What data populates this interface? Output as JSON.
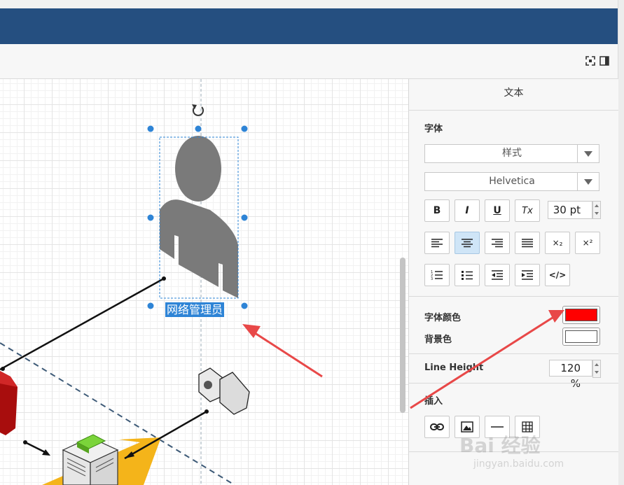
{
  "panel": {
    "title": "文本",
    "font_section": "字体",
    "style_select": "样式",
    "font_select": "Helvetica",
    "bold": "B",
    "italic": "I",
    "underline": "U",
    "clear_format": "Tx",
    "font_size": "30 pt",
    "subscript": "×₂",
    "superscript": "×²",
    "html": "</>",
    "font_color_label": "字体颜色",
    "bg_color_label": "背景色",
    "line_height_label": "Line Height",
    "line_height_value": "120 %",
    "insert_label": "插入",
    "font_color": "#ff0000",
    "bg_color": "#ffffff"
  },
  "canvas": {
    "selected_label": "网络管理员"
  },
  "watermark": {
    "brand": "Bai 经验",
    "url": "jingyan.baidu.com"
  },
  "colors": {
    "titlebar": "#254f80",
    "selection": "#2e84d6",
    "arrow": "#e84848"
  }
}
